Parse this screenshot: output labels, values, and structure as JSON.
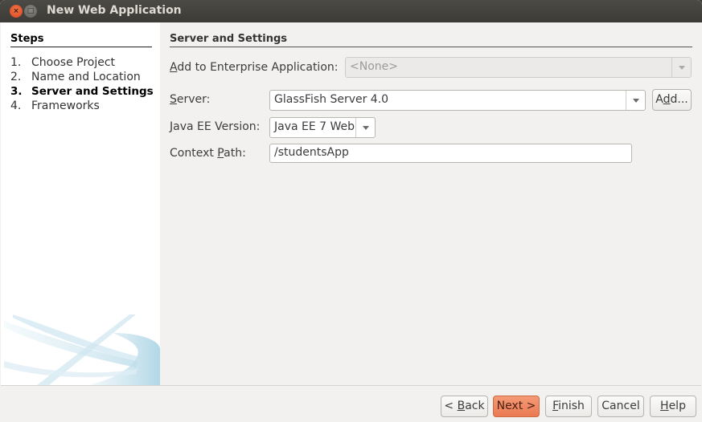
{
  "window": {
    "title": "New Web Application",
    "controls": {
      "close": "×",
      "minimize": "□"
    }
  },
  "steps": {
    "title": "Steps",
    "items": [
      {
        "num": "1.",
        "label": "Choose Project",
        "active": false
      },
      {
        "num": "2.",
        "label": "Name and Location",
        "active": false
      },
      {
        "num": "3.",
        "label": "Server and Settings",
        "active": true
      },
      {
        "num": "4.",
        "label": "Frameworks",
        "active": false
      }
    ]
  },
  "panel": {
    "title": "Server and Settings",
    "enterprise_app": {
      "label_mnemonic": "A",
      "label_rest": "dd to Enterprise Application:",
      "value": "<None>",
      "enabled": false
    },
    "server": {
      "label_mnemonic": "S",
      "label_rest": "erver:",
      "value": "GlassFish Server 4.0",
      "add_label_pre": "A",
      "add_label_mnemonic": "d",
      "add_label_post": "d..."
    },
    "java_ee": {
      "label_mnemonic": "J",
      "label_rest": "ava EE Version:",
      "value": "Java EE 7 Web"
    },
    "context_path": {
      "label_pre": "Context ",
      "label_mnemonic": "P",
      "label_rest": "ath:",
      "value": "/studentsApp"
    }
  },
  "buttons": {
    "back_pre": "< ",
    "back_mnemonic": "B",
    "back_post": "ack",
    "next": "Next >",
    "finish_mnemonic": "F",
    "finish_post": "inish",
    "cancel": "Cancel",
    "help_mnemonic": "H",
    "help_post": "elp"
  },
  "colors": {
    "accent": "#ea7a52",
    "titlebar": "#3c3b37",
    "close": "#e0532b"
  }
}
